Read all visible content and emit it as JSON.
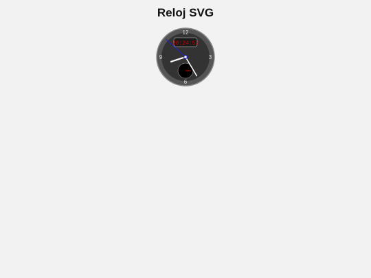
{
  "page": {
    "title": "Reloj SVG"
  },
  "clock": {
    "numerals": {
      "twelve": "12",
      "three": "3",
      "six": "6",
      "nine": "9"
    },
    "digital_time": "20:24:52",
    "time": {
      "hours": 20,
      "minutes": 24,
      "seconds": 52
    },
    "colors": {
      "face_outer": "#555555",
      "face_inner": "#333333",
      "ring": "#888888",
      "numerals": "#dddddd",
      "hour_hand": "#ffffff",
      "minute_hand": "#ffffff",
      "second_hand": "#2222cc",
      "digital_text": "#cc0000",
      "digital_bg": "#1a1a1a",
      "subdial_bg": "#000000",
      "subdial_hand": "#cc0000",
      "center_pin": "#2222cc"
    }
  }
}
